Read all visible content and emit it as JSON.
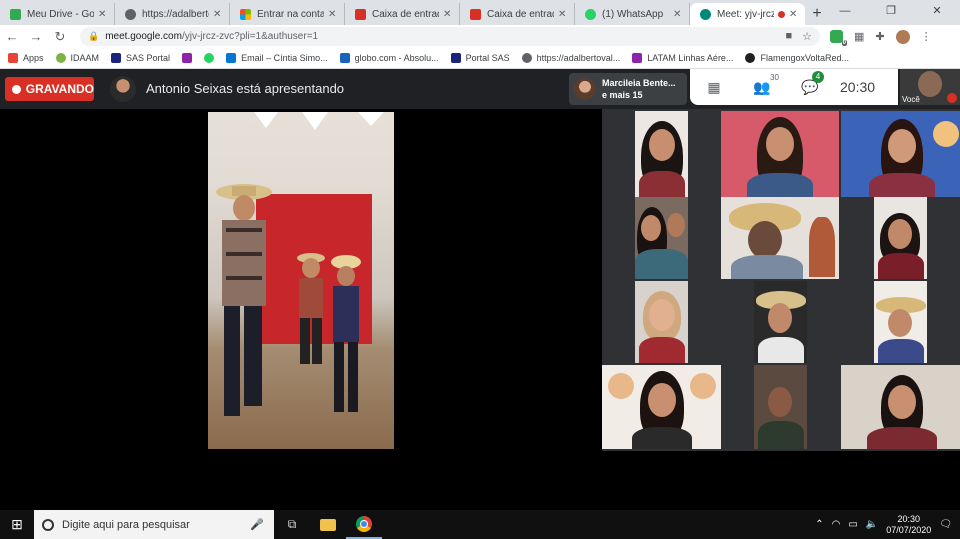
{
  "browser": {
    "tabs": [
      {
        "title": "Meu Drive - Goog",
        "color": "#34a853"
      },
      {
        "title": "https://adalbertov",
        "color": "#5f6368"
      },
      {
        "title": "Entrar na conta de",
        "color": "#f25022"
      },
      {
        "title": "Caixa de entrada",
        "color": "#d93025"
      },
      {
        "title": "Caixa de entrada",
        "color": "#d93025"
      },
      {
        "title": "(1) WhatsApp",
        "color": "#25d366"
      },
      {
        "title": "Meet: yjv-jrcz",
        "color": "#00897b"
      }
    ],
    "new_tab": "+",
    "url_host": "meet.google.com",
    "url_path": "/yjv-jrcz-zvc?pli=1&authuser=1",
    "extension_badge": "0",
    "bookmarks": [
      {
        "label": "Apps",
        "color": "#ea4335"
      },
      {
        "label": "IDAAM",
        "color": "#7cb342"
      },
      {
        "label": "SAS Portal",
        "color": "#1a237e"
      },
      {
        "label": "",
        "color": "#8e24aa"
      },
      {
        "label": "",
        "color": "#25d366"
      },
      {
        "label": "Email – Cíntia Simo...",
        "color": "#0078d4"
      },
      {
        "label": "globo.com - Absolu...",
        "color": "#1565c0"
      },
      {
        "label": "Portal SAS",
        "color": "#1a237e"
      },
      {
        "label": "https://adalbertoval...",
        "color": "#5f6368"
      },
      {
        "label": "LATAM Linhas Aére...",
        "color": "#8e24aa"
      },
      {
        "label": "FlamengoxVoltaRed...",
        "color": "#212121"
      }
    ]
  },
  "meet": {
    "recording_label": "GRAVANDO",
    "presenter_text": "Antonio Seixas está apresentando",
    "participant_chip": {
      "name": "Marcileia Bente...",
      "more": "e mais 15"
    },
    "people_count": "30",
    "chat_badge": "4",
    "clock": "20:30",
    "self_label": "Você"
  },
  "taskbar": {
    "search_placeholder": "Digite aqui para pesquisar",
    "time": "20:30",
    "date": "07/07/2020"
  }
}
